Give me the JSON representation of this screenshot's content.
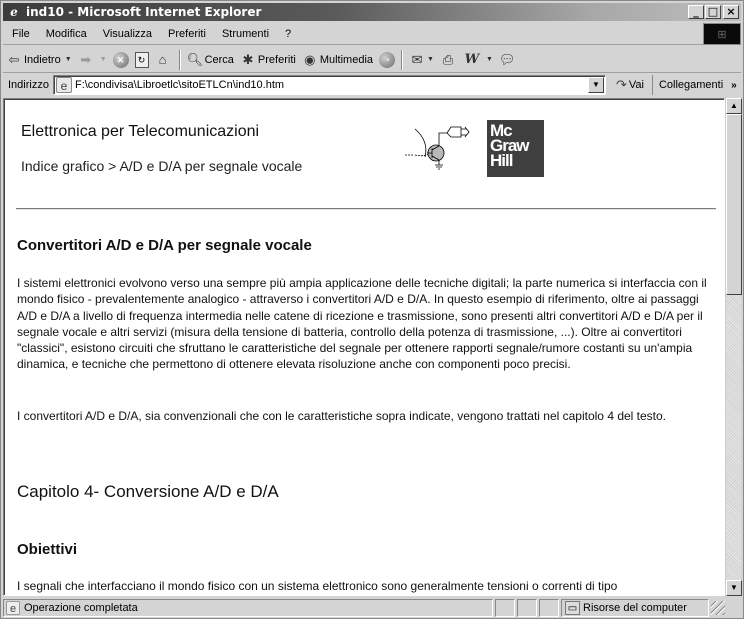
{
  "window": {
    "title": "ind10 - Microsoft Internet Explorer",
    "controls": {
      "minimize": "_",
      "maximize": "□",
      "close": "×"
    }
  },
  "menubar": {
    "items": [
      {
        "label": "File"
      },
      {
        "label": "Modifica"
      },
      {
        "label": "Visualizza"
      },
      {
        "label": "Preferiti"
      },
      {
        "label": "Strumenti"
      },
      {
        "label": "?"
      }
    ]
  },
  "toolbar": {
    "back": {
      "label": "Indietro",
      "icon": "back-arrow-icon"
    },
    "forward": {
      "icon": "forward-arrow-icon"
    },
    "stop": {
      "icon": "stop-icon"
    },
    "refresh": {
      "icon": "refresh-icon"
    },
    "home": {
      "icon": "home-icon"
    },
    "search": {
      "label": "Cerca",
      "icon": "search-icon"
    },
    "favorites": {
      "label": "Preferiti",
      "icon": "favorites-icon"
    },
    "multimedia": {
      "label": "Multimedia",
      "icon": "multimedia-icon"
    },
    "history": {
      "icon": "history-icon"
    },
    "mail": {
      "icon": "mail-icon"
    },
    "print": {
      "icon": "print-icon"
    },
    "edit": {
      "icon": "word-edit-icon"
    },
    "discuss": {
      "icon": "discuss-icon"
    }
  },
  "addressbar": {
    "label": "Indirizzo",
    "value": "F:\\condivisa\\Libroetlc\\sitoETLCn\\ind10.htm",
    "go_label": "Vai",
    "links_label": "Collegamenti",
    "links_more": "»"
  },
  "page": {
    "site_title": "Elettronica per Telecomunicazioni",
    "breadcrumb": "Indice grafico > A/D e D/A per segnale vocale",
    "logo_lines": [
      "Mc",
      "Graw",
      "Hill"
    ],
    "section_heading": "Convertitori A/D e D/A per segnale vocale",
    "paragraph1": "I sistemi elettronici evolvono verso una sempre più ampia applicazione delle tecniche digitali; la parte numerica si interfaccia con il mondo fisico - prevalentemente analogico - attraverso i convertitori A/D e D/A. In questo esempio di riferimento, oltre ai passaggi A/D e D/A a livello di frequenza intermedia nelle catene di ricezione e trasmissione, sono presenti altri convertitori A/D e D/A per il segnale vocale e altri servizi (misura della tensione di batteria, controllo della potenza di trasmissione, ...). Oltre ai convertitori \"classici\", esistono circuiti che sfruttano le caratteristiche del segnale per ottenere rapporti segnale/rumore costanti su un'ampia dinamica, e tecniche che permettono di ottenere elevata risoluzione anche con componenti poco precisi.",
    "paragraph2": "I convertitori A/D e D/A, sia convenzionali che con le caratteristiche sopra indicate, vengono trattati nel capitolo 4 del testo.",
    "chapter_heading": "Capitolo 4- Conversione A/D e D/A",
    "objectives_heading": "Obiettivi",
    "paragraph3": "I segnali che interfacciano il mondo fisico con un sistema elettronico sono generalmente tensioni o correnti di tipo"
  },
  "statusbar": {
    "status_text": "Operazione completata",
    "zone_text": "Risorse del computer"
  }
}
